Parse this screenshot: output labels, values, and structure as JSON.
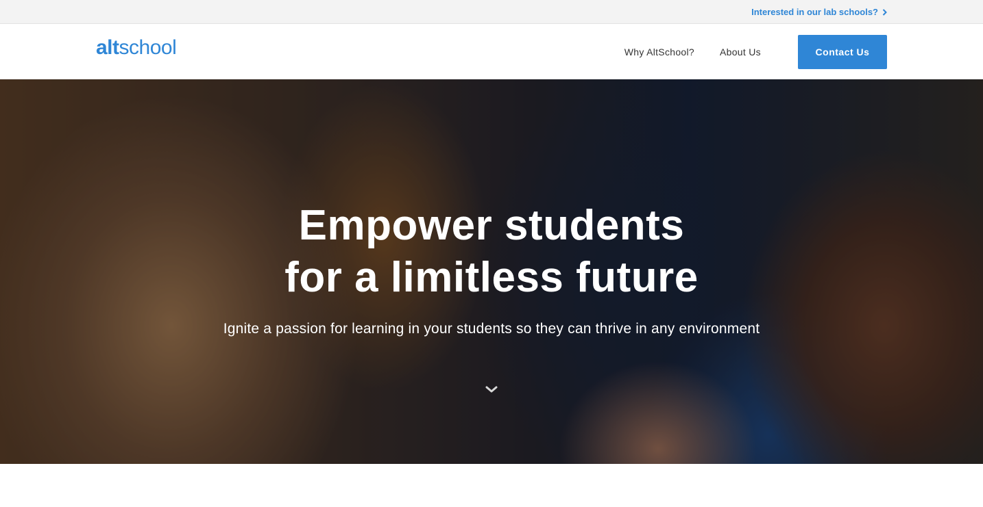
{
  "topbar": {
    "link_label": "Interested in our lab schools?",
    "icon": "chevron-right-icon"
  },
  "nav": {
    "logo": {
      "part1": "alt",
      "part2": "school"
    },
    "links": [
      {
        "label": "Why AltSchool?"
      },
      {
        "label": "About Us"
      }
    ],
    "cta_label": "Contact Us"
  },
  "hero": {
    "title_line1": "Empower students",
    "title_line2": "for a limitless future",
    "subtitle": "Ignite a passion for learning in your students so they can thrive in any environment",
    "scroll_icon": "chevron-down-icon"
  },
  "colors": {
    "accent": "#2f86d6",
    "topbar_bg": "#f3f3f3",
    "nav_text": "#333333"
  }
}
